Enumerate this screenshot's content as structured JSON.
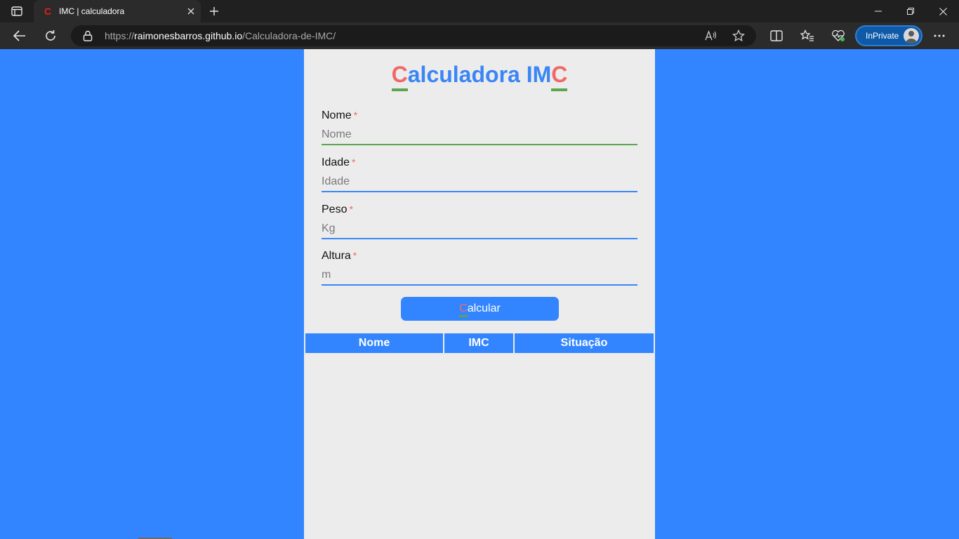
{
  "browser": {
    "tab": {
      "favicon": "C",
      "title": "IMC | calculadora"
    },
    "address": {
      "url_prefix": "https://",
      "host": "raimonesbarros.github.io",
      "path": "/Calculadora-de-IMC/"
    },
    "inprivate_label": "InPrivate",
    "icons": [
      "tab-actions-icon",
      "close-icon",
      "plus-icon",
      "minimize-icon",
      "restore-icon",
      "close-window-icon",
      "back-arrow-icon",
      "refresh-icon",
      "lock-icon",
      "read-aloud-icon",
      "favorite-star-icon",
      "split-screen-icon",
      "favorites-icon",
      "browser-essentials-icon",
      "more-icon"
    ]
  },
  "app": {
    "title": {
      "first": "C",
      "middle": "alculadora IM",
      "last": "C"
    },
    "fields": [
      {
        "label": "Nome",
        "required": "*",
        "placeholder": "Nome"
      },
      {
        "label": "Idade",
        "required": "*",
        "placeholder": "Idade"
      },
      {
        "label": "Peso",
        "required": "*",
        "placeholder": "Kg"
      },
      {
        "label": "Altura",
        "required": "*",
        "placeholder": "m"
      }
    ],
    "button": {
      "first": "C",
      "rest": "alcular"
    },
    "table": {
      "headers": [
        "Nome",
        "IMC",
        "Situação"
      ]
    }
  },
  "colors": {
    "page_bg": "#3385ff",
    "card_bg": "#ececec",
    "title_blue": "#3a86f6",
    "accent_red": "#f06868",
    "accent_green": "#5aa54e"
  }
}
